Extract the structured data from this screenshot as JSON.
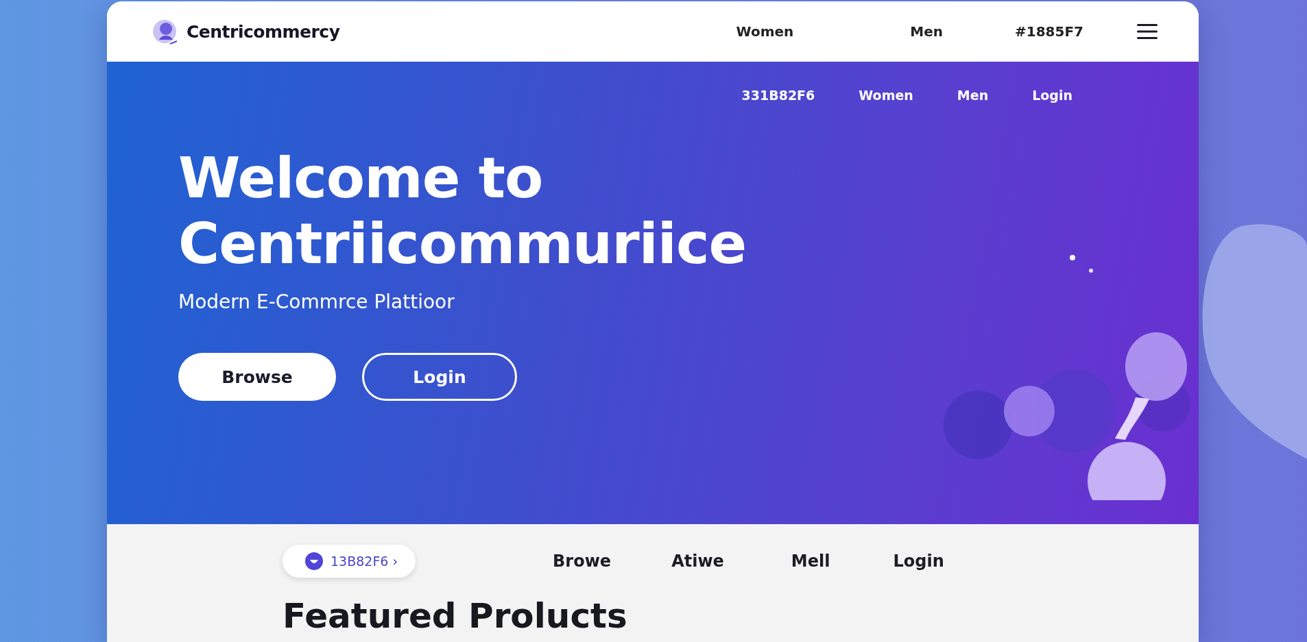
{
  "header": {
    "brand": "Centricommercy",
    "nav": [
      "Women",
      "Men",
      "#1885F7"
    ]
  },
  "hero": {
    "nav": [
      "331B82F6",
      "Women",
      "Men",
      "Login"
    ],
    "title_lines": [
      "Welcome to",
      "Centriicommuriice"
    ],
    "subtitle": "Modern E-Commrce Plattioor",
    "buttons": [
      {
        "label": "Browse",
        "kind": "solid"
      },
      {
        "label": "Login",
        "kind": "outline"
      }
    ]
  },
  "subnav": {
    "pill": "13B82F6 ›",
    "items": [
      "Browe",
      "Atiwe",
      "Mell",
      "Login"
    ]
  },
  "section": {
    "heading": "Featured Prolucts"
  }
}
